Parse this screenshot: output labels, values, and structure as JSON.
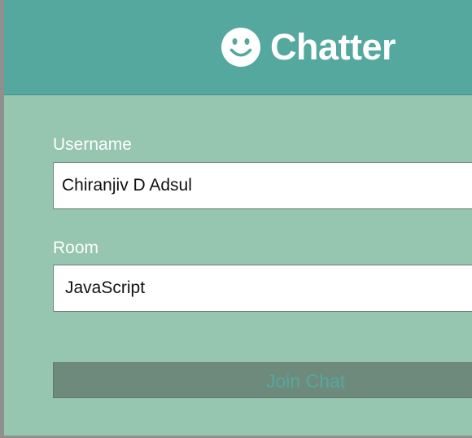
{
  "header": {
    "logo_icon": "smile-icon",
    "title": "Chatter"
  },
  "form": {
    "username_label": "Username",
    "username_value": "Chiranjiv D Adsul",
    "room_label": "Room",
    "room_value": "JavaScript",
    "join_label": "Join Chat"
  },
  "colors": {
    "header_bg": "#55a89e",
    "body_bg": "#96c5b0",
    "button_bg": "#6e8a7c",
    "button_text": "#55a89e",
    "text_light": "#ffffff"
  }
}
